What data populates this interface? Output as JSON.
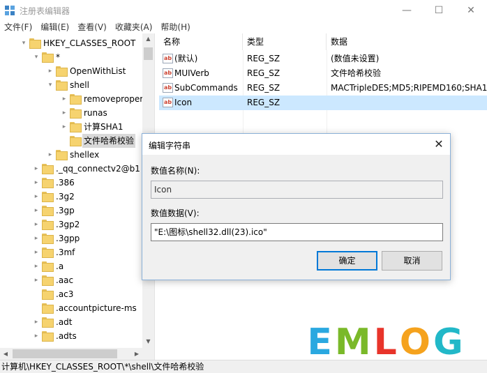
{
  "window": {
    "title": "注册表编辑器",
    "minimize_glyph": "—",
    "maximize_glyph": "☐",
    "close_glyph": "✕"
  },
  "menu": [
    {
      "label": "文件(F)"
    },
    {
      "label": "编辑(E)"
    },
    {
      "label": "查看(V)"
    },
    {
      "label": "收藏夹(A)"
    },
    {
      "label": "帮助(H)"
    }
  ],
  "tree": {
    "nodes": [
      {
        "label": "HKEY_CLASSES_ROOT",
        "level": 0,
        "expander": "open"
      },
      {
        "label": "*",
        "level": 1,
        "expander": "open"
      },
      {
        "label": "OpenWithList",
        "level": 2,
        "expander": "closed"
      },
      {
        "label": "shell",
        "level": 2,
        "expander": "open"
      },
      {
        "label": "removeproper",
        "level": 3,
        "expander": "closed"
      },
      {
        "label": "runas",
        "level": 3,
        "expander": "closed"
      },
      {
        "label": "计算SHA1",
        "level": 3,
        "expander": "closed"
      },
      {
        "label": "文件哈希校验",
        "level": 3,
        "expander": "none",
        "selected": true
      },
      {
        "label": "shellex",
        "level": 2,
        "expander": "closed"
      },
      {
        "label": "._qq_connectv2@b1",
        "level": 1,
        "expander": "closed"
      },
      {
        "label": ".386",
        "level": 1,
        "expander": "closed"
      },
      {
        "label": ".3g2",
        "level": 1,
        "expander": "closed"
      },
      {
        "label": ".3gp",
        "level": 1,
        "expander": "closed"
      },
      {
        "label": ".3gp2",
        "level": 1,
        "expander": "closed"
      },
      {
        "label": ".3gpp",
        "level": 1,
        "expander": "closed"
      },
      {
        "label": ".3mf",
        "level": 1,
        "expander": "closed"
      },
      {
        "label": ".a",
        "level": 1,
        "expander": "closed"
      },
      {
        "label": ".aac",
        "level": 1,
        "expander": "closed"
      },
      {
        "label": ".ac3",
        "level": 1,
        "expander": "none"
      },
      {
        "label": ".accountpicture-ms",
        "level": 1,
        "expander": "none"
      },
      {
        "label": ".adt",
        "level": 1,
        "expander": "closed"
      },
      {
        "label": ".adts",
        "level": 1,
        "expander": "closed"
      }
    ]
  },
  "list": {
    "headers": {
      "name": "名称",
      "type": "类型",
      "data": "数据"
    },
    "rows": [
      {
        "name": "(默认)",
        "type": "REG_SZ",
        "data": "(数值未设置)"
      },
      {
        "name": "MUIVerb",
        "type": "REG_SZ",
        "data": "文件哈希校验"
      },
      {
        "name": "SubCommands",
        "type": "REG_SZ",
        "data": "MACTripleDES;MD5;RIPEMD160;SHA1;"
      },
      {
        "name": "Icon",
        "type": "REG_SZ",
        "data": "",
        "selected": true
      }
    ],
    "icon_glyph": "ab"
  },
  "status": {
    "path": "计算机\\HKEY_CLASSES_ROOT\\*\\shell\\文件哈希校验"
  },
  "dialog": {
    "title": "编辑字符串",
    "close_glyph": "✕",
    "name_label": "数值名称(N):",
    "name_value": "Icon",
    "data_label": "数值数据(V):",
    "data_value": "\"E:\\图标\\shell32.dll(23).ico\"",
    "ok_label": "确定",
    "cancel_label": "取消"
  },
  "watermark": {
    "letters": [
      {
        "char": "E",
        "color": "#2aa8e0"
      },
      {
        "char": "M",
        "color": "#7ab929"
      },
      {
        "char": "L",
        "color": "#e8342a"
      },
      {
        "char": "O",
        "color": "#f5a21d"
      },
      {
        "char": "G",
        "color": "#22b8c8"
      }
    ]
  }
}
